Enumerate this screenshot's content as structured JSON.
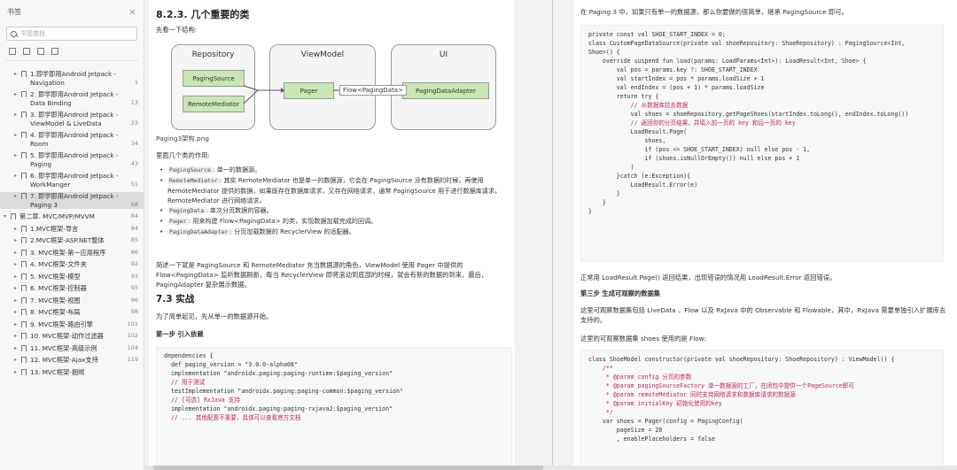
{
  "sidebar": {
    "title": "书签",
    "close_glyph": "×",
    "search_placeholder": "书签查找",
    "items": [
      {
        "label": "1.即学即用Android Jetpack - Navigation",
        "page": "1",
        "level": 1
      },
      {
        "label": "2. 即学即用Android Jetpack - Data Binding",
        "page": "13",
        "level": 1
      },
      {
        "label": "3. 即学即用Android Jetpack - ViewModel & LiveData",
        "page": "23",
        "level": 1
      },
      {
        "label": "4. 即学即用Android Jetpack - Room",
        "page": "34",
        "level": 1
      },
      {
        "label": "5. 即学即用Android Jetpack - Paging",
        "page": "43",
        "level": 1
      },
      {
        "label": "6. 即学即用Android Jetpack - WorkManger",
        "page": "51",
        "level": 1
      },
      {
        "label": "7. 即学即用Android Jetpack - Paging 3",
        "page": "68",
        "level": 1,
        "active": true
      },
      {
        "label": "第二章. MVC/MVP/MVVM",
        "page": "84",
        "level": 0
      },
      {
        "label": "1.MVC框架-导言",
        "page": "84",
        "level": 1
      },
      {
        "label": "2.MVC框架-ASP.NET整体",
        "page": "85",
        "level": 1
      },
      {
        "label": "3. MVC框架-第一应用程序",
        "page": "86",
        "level": 1
      },
      {
        "label": "4. MVC框架-文件夹",
        "page": "92",
        "level": 1
      },
      {
        "label": "5. MVC框架-模型",
        "page": "93",
        "level": 1
      },
      {
        "label": "6. MVC框架-控制器",
        "page": "95",
        "level": 1
      },
      {
        "label": "7. MVC框架-视图",
        "page": "96",
        "level": 1
      },
      {
        "label": "8. MVC框架-布局",
        "page": "98",
        "level": 1
      },
      {
        "label": "9. MVC框架-路由引擎",
        "page": "101",
        "level": 1
      },
      {
        "label": "10. MVC框架-动作过滤器",
        "page": "102",
        "level": 1
      },
      {
        "label": "11. MVC框架-高级示例",
        "page": "104",
        "level": 1
      },
      {
        "label": "12. MVC框架-Ajax支持",
        "page": "119",
        "level": 1
      },
      {
        "label": "13. MVC框架-捆绑",
        "page": "",
        "level": 1
      }
    ]
  },
  "left_page": {
    "heading": "8.2.3. 几个重要的类",
    "intro": "先看一下结构:",
    "diagram": {
      "groups": [
        "Repository",
        "ViewModel",
        "UI"
      ],
      "nodes": [
        "PagingSource",
        "RemoteMediator",
        "Pager",
        "PagingDataAdapter"
      ],
      "edge_label": "Flow<PagingData>"
    },
    "caption": "Paging3架构.png",
    "roles_intro": "里面几个类的作用:",
    "bullets": [
      {
        "code": "PagingSource",
        "text": ": 单一的数据源。"
      },
      {
        "code": "RemoteMediator",
        "text": ": 其实 RemoteMediator 也是单一的数据源，它会在 PagingSource 没有数据的时候，再使用 RemoteMediator 提供的数据，如果既存在数据库请求，又存在网络请求，通常 PagingSource 用于进行数据库请求，RemoteMediator 进行网络请求。"
      },
      {
        "code": "PagingData",
        "text": ": 单次分页数据的容器。"
      },
      {
        "code": "Pager",
        "text": ": 用来构建 Flow<PagingData> 的类，实现数据加载完成的回调。"
      },
      {
        "code": "PagingDataAdapter",
        "text": ": 分页加载数据的 RecyclerView 的适配器。"
      }
    ],
    "summary": "简述一下就是 PagingSource 和 RemoteMediator 充当数据源的角色，ViewModel 使用 Pager 中提供的 Flow<PagingData> 监听数据刷新，每当 RecyclerView 即将滚动到底部的时候，就会有新的数据的到来，最后，PagingAdapter 复杂展示数据。",
    "section": "7.3 实战",
    "section_intro": "为了简单起见，先从单一的数据源开始。",
    "step1": "第一步 引入依赖",
    "code_lines": [
      "dependencies {",
      "  def paging_version = \"3.0.0-alpha08\"",
      "",
      "  implementation \"androidx.paging:paging-runtime:$paging_version\"",
      "",
      "  // 用于测试",
      "  testImplementation \"androidx.paging:paging-common:$paging_version\"",
      "",
      "  // [可选] RxJava 支持",
      "  implementation \"androidx.paging:paging-rxjava2:$paging_version\"",
      "",
      "  // ... 其他配置不重要，具体可以查看官方文档"
    ]
  },
  "right_page": {
    "intro": "在 Paging 3 中，如果只有单一的数据源，那么你要做的很简单，继承 PagingSource 即可。",
    "code1_lines": [
      "private const val SHOE_START_INDEX = 0;",
      "",
      "class CustomPageDataSource(private val shoeRepository: ShoeRepository) : PagingSource<Int,",
      "Shoe>() {",
      "",
      "    override suspend fun load(params: LoadParams<Int>): LoadResult<Int, Shoe> {",
      "        val pos = params.key ?: SHOE_START_INDEX",
      "        val startIndex = pos * params.loadSize + 1",
      "        val endIndex = (pos + 1) * params.loadSize",
      "        return try {",
      "            // 从数据库拉去数据",
      "            val shoes = shoeRepository.getPageShoes(startIndex.toLong(), endIndex.toLong())",
      "            // 返回你的分页结果，并填入前一页的 key 和后一页的 key",
      "            LoadResult.Page(",
      "                shoes,",
      "                if (pos <= SHOE_START_INDEX) null else pos - 1,",
      "                if (shoes.isNullOrEmpty()) null else pos + 1",
      "            )",
      "        }catch (e:Exception){",
      "            LoadResult.Error(e)",
      "        }",
      "",
      "    }",
      "}"
    ],
    "after_code": "正常用 LoadResult.Page() 返回结果，出现错误的情况用 LoadResult.Error 返回错误。",
    "step3": "第三步 生成可观察的数据集",
    "step3_p1": "这里可观察数据集包括 LiveData 、Flow 以及 RxJava 中的 Observable 和 Flowable，其中，RxJava 需要单独引入扩展库去支持的。",
    "step3_p2": "这里的可观察数据集 shoes 使用的是 Flow:",
    "code2_lines": [
      "class ShoeModel constructor(private val shoeRepository: ShoeRepository) : ViewModel() {",
      "",
      "    /**",
      "     * @param config 分页的参数",
      "     * @param pagingSourceFactory 单一数据源的工厂，在闭包中提供一个PageSource即可",
      "     * @param remoteMediator 同时支持网络请求和数据库请求的数据源",
      "     * @param initialKey 初始化使用的key",
      "     */",
      "    var shoes = Pager(config = PagingConfig(",
      "        pageSize = 20",
      "        , enablePlaceholders = false"
    ]
  }
}
